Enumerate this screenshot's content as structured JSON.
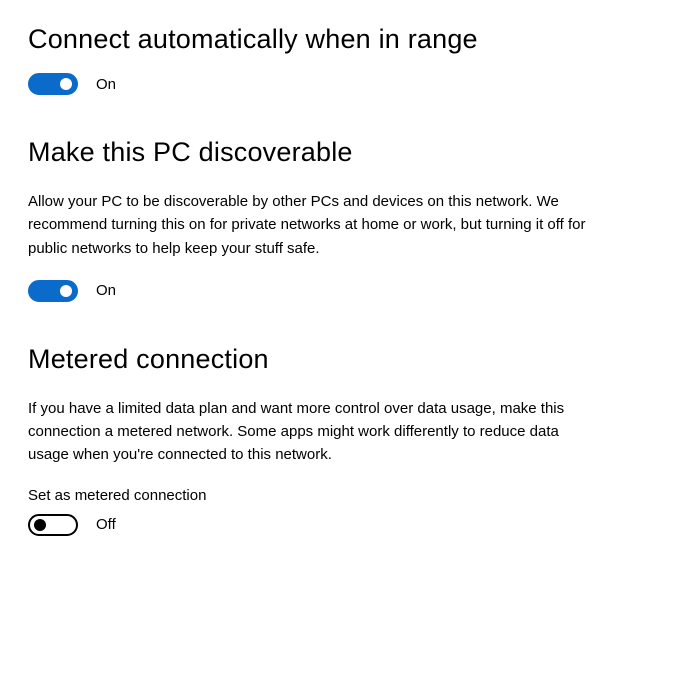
{
  "connect": {
    "title": "Connect automatically when in range",
    "state_label": "On",
    "on": true
  },
  "discoverable": {
    "title": "Make this PC discoverable",
    "description": "Allow your PC to be discoverable by other PCs and devices on this network. We recommend turning this on for private networks at home or work, but turning it off for public networks to help keep your stuff safe.",
    "state_label": "On",
    "on": true
  },
  "metered": {
    "title": "Metered connection",
    "description": "If you have a limited data plan and want more control over data usage, make this connection a metered network. Some apps might work differently to reduce data usage when you're connected to this network.",
    "sub_label": "Set as metered connection",
    "state_label": "Off",
    "on": false
  }
}
